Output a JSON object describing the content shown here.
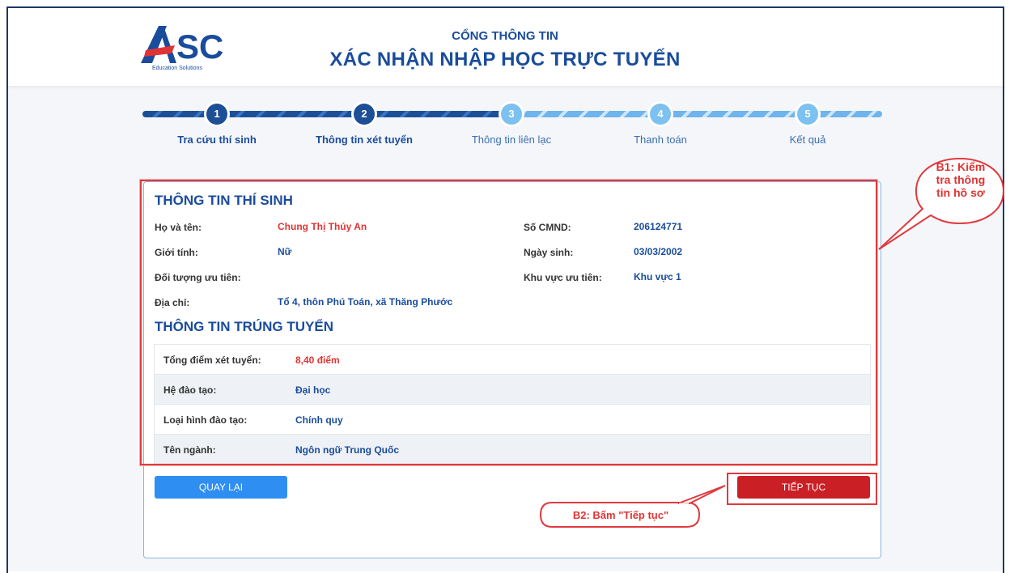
{
  "logo": {
    "text": "SC",
    "tagline": "Education Solutions"
  },
  "header": {
    "portal_label": "CỔNG THÔNG TIN",
    "title": "XÁC NHẬN NHẬP HỌC TRỰC TUYẾN"
  },
  "steps": [
    {
      "number": "1",
      "label": "Tra cứu thí sinh",
      "state": "done"
    },
    {
      "number": "2",
      "label": "Thông tin xét tuyển",
      "state": "current"
    },
    {
      "number": "3",
      "label": "Thông tin liên lạc",
      "state": "todo"
    },
    {
      "number": "4",
      "label": "Thanh toán",
      "state": "todo"
    },
    {
      "number": "5",
      "label": "Kết quả",
      "state": "todo"
    }
  ],
  "candidate": {
    "section_title": "THÔNG TIN THÍ SINH",
    "name_label": "Họ và tên:",
    "name": "Chung Thị Thúy An",
    "id_label": "Số CMND:",
    "id_number": "206124771",
    "gender_label": "Giới tính:",
    "gender": "Nữ",
    "dob_label": "Ngày sinh:",
    "dob": "03/03/2002",
    "priority_group_label": "Đối tượng ưu tiên:",
    "priority_group": "",
    "priority_area_label": "Khu vực ưu tiên:",
    "priority_area": "Khu vực 1",
    "address_label": "Địa chỉ:",
    "address": "Tổ 4, thôn Phú Toán, xã Thăng Phước"
  },
  "admission": {
    "section_title": "THÔNG TIN TRÚNG TUYỂN",
    "rows": [
      {
        "label": "Tổng điểm xét tuyển:",
        "value": "8,40 điểm"
      },
      {
        "label": "Hệ đào tạo:",
        "value": "Đại học"
      },
      {
        "label": "Loại hình đào tạo:",
        "value": "Chính quy"
      },
      {
        "label": "Tên ngành:",
        "value": "Ngôn ngữ Trung Quốc"
      }
    ]
  },
  "buttons": {
    "back": "QUAY LẠI",
    "next": "TIẾP TỤC"
  },
  "annotations": {
    "b1": [
      "B1: Kiểm",
      "tra thông",
      "tin hồ sơ"
    ],
    "b2": "B2: Bấm \"Tiếp tục\""
  },
  "colors": {
    "brand_blue": "#1a4c9c",
    "accent_red": "#c91f25",
    "button_blue": "#2f8ef2",
    "annotation_red": "#e0393e"
  }
}
